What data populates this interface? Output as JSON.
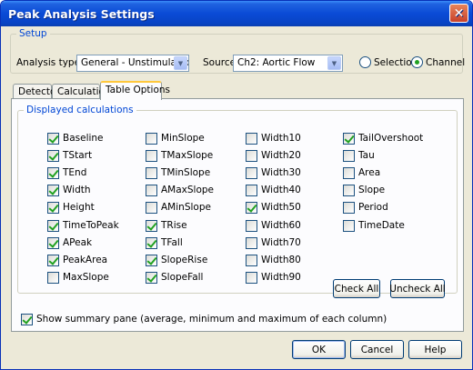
{
  "window": {
    "title": "Peak Analysis Settings"
  },
  "setup": {
    "legend": "Setup",
    "analysis_type_label": "Analysis type:",
    "analysis_type_value": "General - Unstimulated",
    "source_label": "Source:",
    "source_value": "Ch2: Aortic Flow",
    "radios": [
      {
        "label": "Selection",
        "selected": false
      },
      {
        "label": "Channel",
        "selected": true
      }
    ]
  },
  "tabs": [
    {
      "label": "Detector",
      "active": false
    },
    {
      "label": "Calculations",
      "active": false
    },
    {
      "label": "Table Options",
      "active": true
    }
  ],
  "calculations": {
    "legend": "Displayed calculations",
    "columns": [
      [
        {
          "label": "Baseline",
          "checked": true
        },
        {
          "label": "TStart",
          "checked": true
        },
        {
          "label": "TEnd",
          "checked": true
        },
        {
          "label": "Width",
          "checked": true
        },
        {
          "label": "Height",
          "checked": true
        },
        {
          "label": "TimeToPeak",
          "checked": true
        },
        {
          "label": "APeak",
          "checked": true
        },
        {
          "label": "PeakArea",
          "checked": true
        },
        {
          "label": "MaxSlope",
          "checked": false
        }
      ],
      [
        {
          "label": "MinSlope",
          "checked": false
        },
        {
          "label": "TMaxSlope",
          "checked": false
        },
        {
          "label": "TMinSlope",
          "checked": false
        },
        {
          "label": "AMaxSlope",
          "checked": false
        },
        {
          "label": "AMinSlope",
          "checked": false
        },
        {
          "label": "TRise",
          "checked": true
        },
        {
          "label": "TFall",
          "checked": true
        },
        {
          "label": "SlopeRise",
          "checked": true
        },
        {
          "label": "SlopeFall",
          "checked": true
        }
      ],
      [
        {
          "label": "Width10",
          "checked": false
        },
        {
          "label": "Width20",
          "checked": false
        },
        {
          "label": "Width30",
          "checked": false
        },
        {
          "label": "Width40",
          "checked": false
        },
        {
          "label": "Width50",
          "checked": true
        },
        {
          "label": "Width60",
          "checked": false
        },
        {
          "label": "Width70",
          "checked": false
        },
        {
          "label": "Width80",
          "checked": false
        },
        {
          "label": "Width90",
          "checked": false
        }
      ],
      [
        {
          "label": "TailOvershoot",
          "checked": true
        },
        {
          "label": "Tau",
          "checked": false
        },
        {
          "label": "Area",
          "checked": false
        },
        {
          "label": "Slope",
          "checked": false
        },
        {
          "label": "Period",
          "checked": false
        },
        {
          "label": "TimeDate",
          "checked": false
        }
      ]
    ],
    "check_all": "Check All",
    "uncheck_all": "Uncheck All"
  },
  "summary": {
    "label": "Show summary pane (average, minimum and maximum of each column)",
    "checked": true
  },
  "footer": {
    "ok": "OK",
    "cancel": "Cancel",
    "help": "Help"
  }
}
